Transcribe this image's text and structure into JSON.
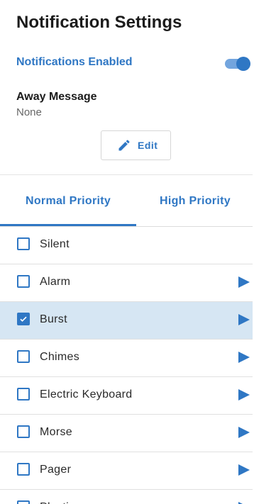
{
  "header": {
    "title": "Notification Settings",
    "notifications_label": "Notifications Enabled",
    "notifications_enabled": true,
    "away_title": "Away Message",
    "away_value": "None",
    "edit_label": "Edit"
  },
  "tabs": [
    {
      "label": "Normal Priority",
      "active": true
    },
    {
      "label": "High Priority",
      "active": false
    }
  ],
  "sounds": [
    {
      "label": "Silent",
      "checked": false,
      "playable": false
    },
    {
      "label": "Alarm",
      "checked": false,
      "playable": true
    },
    {
      "label": "Burst",
      "checked": true,
      "playable": true
    },
    {
      "label": "Chimes",
      "checked": false,
      "playable": true
    },
    {
      "label": "Electric Keyboard",
      "checked": false,
      "playable": true
    },
    {
      "label": "Morse",
      "checked": false,
      "playable": true
    },
    {
      "label": "Pager",
      "checked": false,
      "playable": true
    },
    {
      "label": "Playtime",
      "checked": false,
      "playable": true
    }
  ],
  "colors": {
    "accent": "#2f77c4",
    "selected_row": "#d6e6f3",
    "toggle_track": "#73a5de"
  },
  "icons": {
    "edit": "pencil-icon",
    "play": "play-icon",
    "check": "check-icon"
  }
}
